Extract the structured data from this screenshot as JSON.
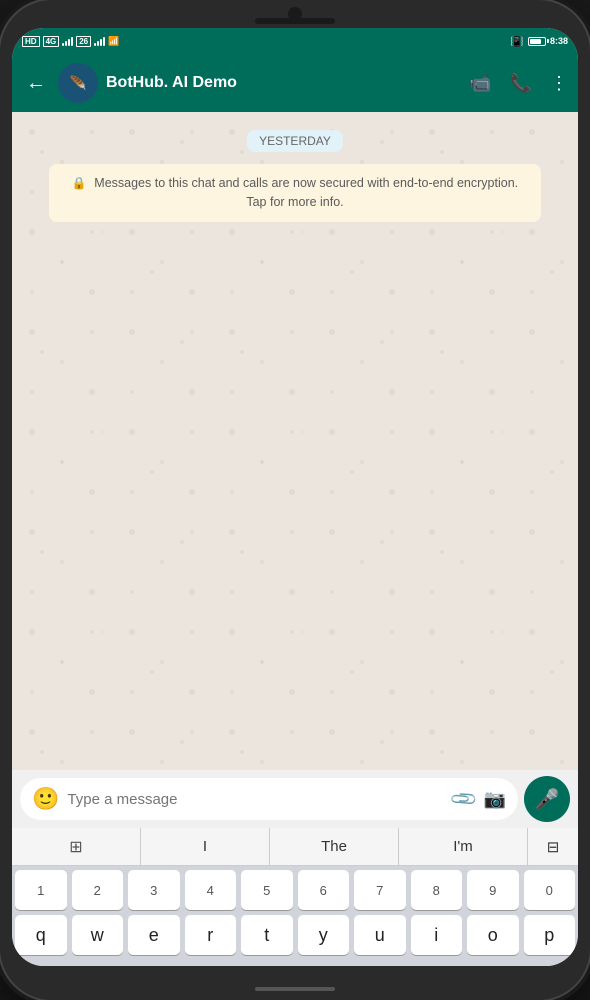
{
  "statusBar": {
    "carrier1": "HD",
    "carrier2": "4G",
    "signal1": "26",
    "wifi": "wifi",
    "time": "8:38",
    "batteryPercent": 70
  },
  "header": {
    "backLabel": "←",
    "contactName": "BotHub. AI Demo",
    "videoCallLabel": "video-call",
    "phoneLabel": "phone",
    "moreLabel": "more"
  },
  "chat": {
    "dateBadge": "YESTERDAY",
    "securityNotice": "Messages to this chat and calls are now secured with end-to-end encryption. Tap for more info."
  },
  "inputBar": {
    "placeholder": "Type a message",
    "emojiLabel": "emoji",
    "attachLabel": "attach",
    "cameraLabel": "camera",
    "micLabel": "microphone"
  },
  "keyboard": {
    "suggestions": [
      "I",
      "The",
      "I'm"
    ],
    "row1": [
      "q",
      "w",
      "e",
      "r",
      "t",
      "y",
      "u",
      "i",
      "o",
      "p"
    ],
    "row1Numbers": [
      "1",
      "2",
      "3",
      "4",
      "5",
      "6",
      "7",
      "8",
      "9",
      "0"
    ]
  }
}
